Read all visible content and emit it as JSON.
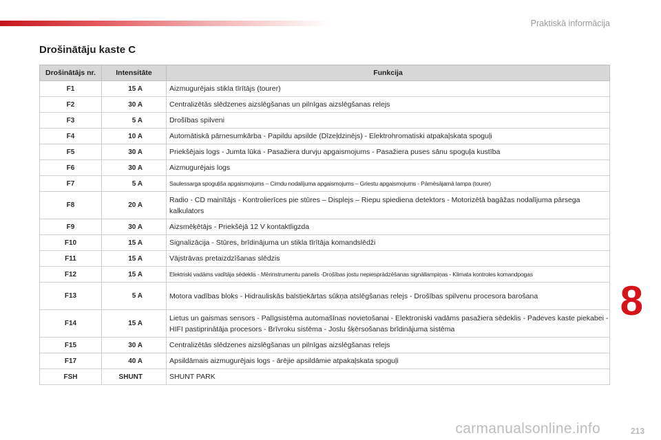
{
  "header": {
    "section": "Praktiskā informācija"
  },
  "title": "Drošinātāju kaste C",
  "table": {
    "columns": [
      "Drošinātājs nr.",
      "Intensitāte",
      "Funkcija"
    ],
    "rows": [
      {
        "nr": "F1",
        "amp": "15 A",
        "func": "Aizmugurējais stikla tīrītājs (tourer)"
      },
      {
        "nr": "F2",
        "amp": "30 A",
        "func": "Centralizētās slēdzenes aizslēgšanas un pilnīgas aizslēgšanas relejs"
      },
      {
        "nr": "F3",
        "amp": "5 A",
        "func": "Drošības spilveni"
      },
      {
        "nr": "F4",
        "amp": "10 A",
        "func": "Automātiskā pārnesumkārba - Papildu apsilde (Dīzeļdzinējs) - Elektrohromatiski atpakaļskata spoguļi"
      },
      {
        "nr": "F5",
        "amp": "30 A",
        "func": "Priekšējais logs - Jumta lūka - Pasažiera durvju apgaismojums - Pasažiera puses sānu spoguļa kustība"
      },
      {
        "nr": "F6",
        "amp": "30 A",
        "func": "Aizmugurējais logs"
      },
      {
        "nr": "F7",
        "amp": "5 A",
        "func": "Saulessarga spoguļiša apgaismojums – Cimdu nodalījuma apgaismojums – Griestu apgaismojums - Pārnēsājamā lampa (tourer)"
      },
      {
        "nr": "F8",
        "amp": "20 A",
        "func": "Radio - CD mainītājs - Kontrolierīces pie stūres – Displejs – Riepu spiediena detektors - Motorizētā bagāžas nodalījuma pārsega kalkulators"
      },
      {
        "nr": "F9",
        "amp": "30 A",
        "func": "Aizsmēķētājs - Priekšējā 12 V kontaktligzda"
      },
      {
        "nr": "F10",
        "amp": "15 A",
        "func": "Signalizācija - Stūres, brīdinājuma un stikla tīrītāja komandslēdži"
      },
      {
        "nr": "F11",
        "amp": "15 A",
        "func": "Vājstrāvas pretaizdzīšanas slēdzis"
      },
      {
        "nr": "F12",
        "amp": "15 A",
        "func": "Elektriski vadāms vadītāja sēdeklis - Mērinstrumentu panelis -Drošības jostu nepiesprādzēšanas signāllampiņas - Klimata kontroles komandpogas"
      },
      {
        "nr": "F13",
        "amp": "5 A",
        "func": "Motora vadības bloks - Hidrauliskās balstiekārtas sūkņa atslēgšanas relejs - Drošības spilvenu procesora barošana"
      },
      {
        "nr": "F14",
        "amp": "15 A",
        "func": "Lietus un gaismas sensors - Palīgsistēma automašīnas novietošanai - Elektroniski vadāms pasažiera sēdeklis - Padeves kaste piekabei - HIFI pastiprinātāja procesors - Brīvroku sistēma - Joslu šķērsošanas brīdinājuma sistēma"
      },
      {
        "nr": "F15",
        "amp": "30 A",
        "func": "Centralizētās slēdzenes aizslēgšanas un pilnīgas aizslēgšanas relejs"
      },
      {
        "nr": "F17",
        "amp": "40 A",
        "func": "Apsildāmais aizmugurējais logs - ārējie apsildāmie atpakaļskata spoguļi"
      },
      {
        "nr": "FSH",
        "amp": "SHUNT",
        "func": "SHUNT PARK"
      }
    ]
  },
  "chapter_number": "8",
  "page_number": "213",
  "watermark": "carmanualsonline.info",
  "colors": {
    "accent": "#d4131a",
    "header_bg": "#d7d7d7"
  }
}
